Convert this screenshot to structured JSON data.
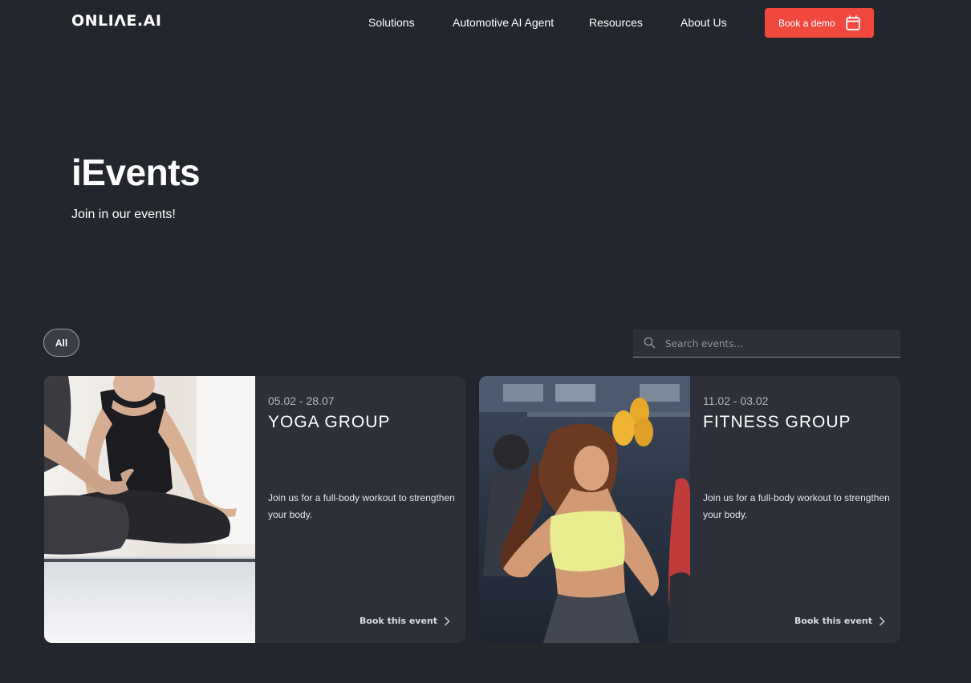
{
  "header": {
    "logo": "ONLIΛE.AI",
    "nav": [
      "Solutions",
      "Automotive AI Agent",
      "Resources",
      "About Us"
    ],
    "cta": "Book a demo"
  },
  "hero": {
    "title": "iEvents",
    "subtitle": "Join in our events!"
  },
  "filters": {
    "all": "All"
  },
  "search": {
    "placeholder": "Search events..."
  },
  "events": [
    {
      "date": "05.02 - 28.07",
      "title": "YOGA GROUP",
      "description": "Join us for a full-body workout to strengthen your body.",
      "link": "Book this event"
    },
    {
      "date": "11.02 - 03.02",
      "title": "FITNESS GROUP",
      "description": "Join us for a full-body workout to strengthen your body.",
      "link": "Book this event"
    }
  ],
  "colors": {
    "background": "#23262d",
    "card": "#2d3038",
    "accent": "#f0473f"
  },
  "icons": {
    "cta": "calendar-icon",
    "search": "search-icon",
    "link": "chevron-right-icon"
  }
}
